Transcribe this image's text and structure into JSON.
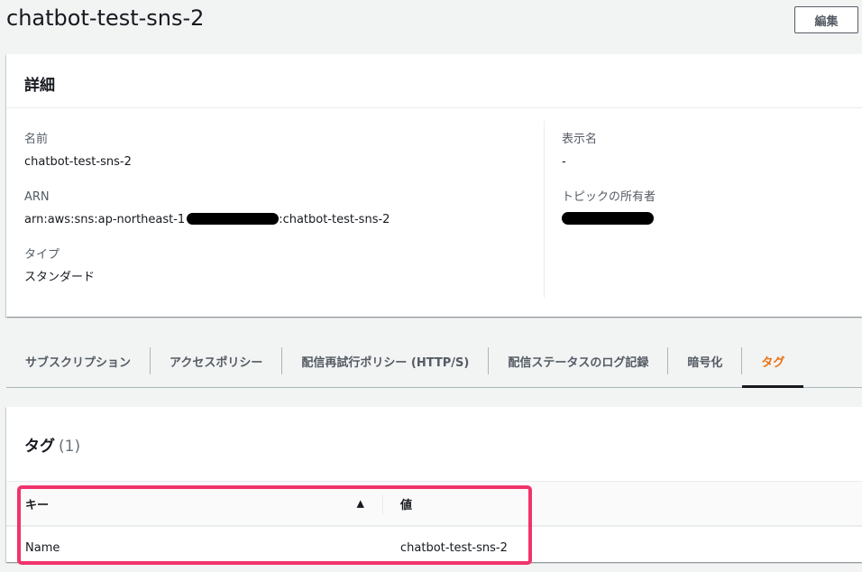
{
  "header": {
    "title": "chatbot-test-sns-2",
    "edit_label": "編集"
  },
  "details": {
    "title": "詳細",
    "name_label": "名前",
    "name_value": "chatbot-test-sns-2",
    "arn_label": "ARN",
    "arn_prefix": "arn:aws:sns:ap-northeast-1",
    "arn_suffix": ":chatbot-test-sns-2",
    "type_label": "タイプ",
    "type_value": "スタンダード",
    "display_name_label": "表示名",
    "display_name_value": "-",
    "owner_label": "トピックの所有者"
  },
  "tabs": [
    {
      "label": "サブスクリプション"
    },
    {
      "label": "アクセスポリシー"
    },
    {
      "label": "配信再試行ポリシー (HTTP/S)"
    },
    {
      "label": "配信ステータスのログ記録"
    },
    {
      "label": "暗号化"
    },
    {
      "label": "タグ"
    }
  ],
  "tags": {
    "title": "タグ",
    "count": "(1)",
    "columns": {
      "key": "キー",
      "value": "値"
    },
    "rows": [
      {
        "key": "Name",
        "value": "chatbot-test-sns-2"
      }
    ]
  },
  "colors": {
    "accent": "#ec7211",
    "highlight": "#f0346b"
  }
}
